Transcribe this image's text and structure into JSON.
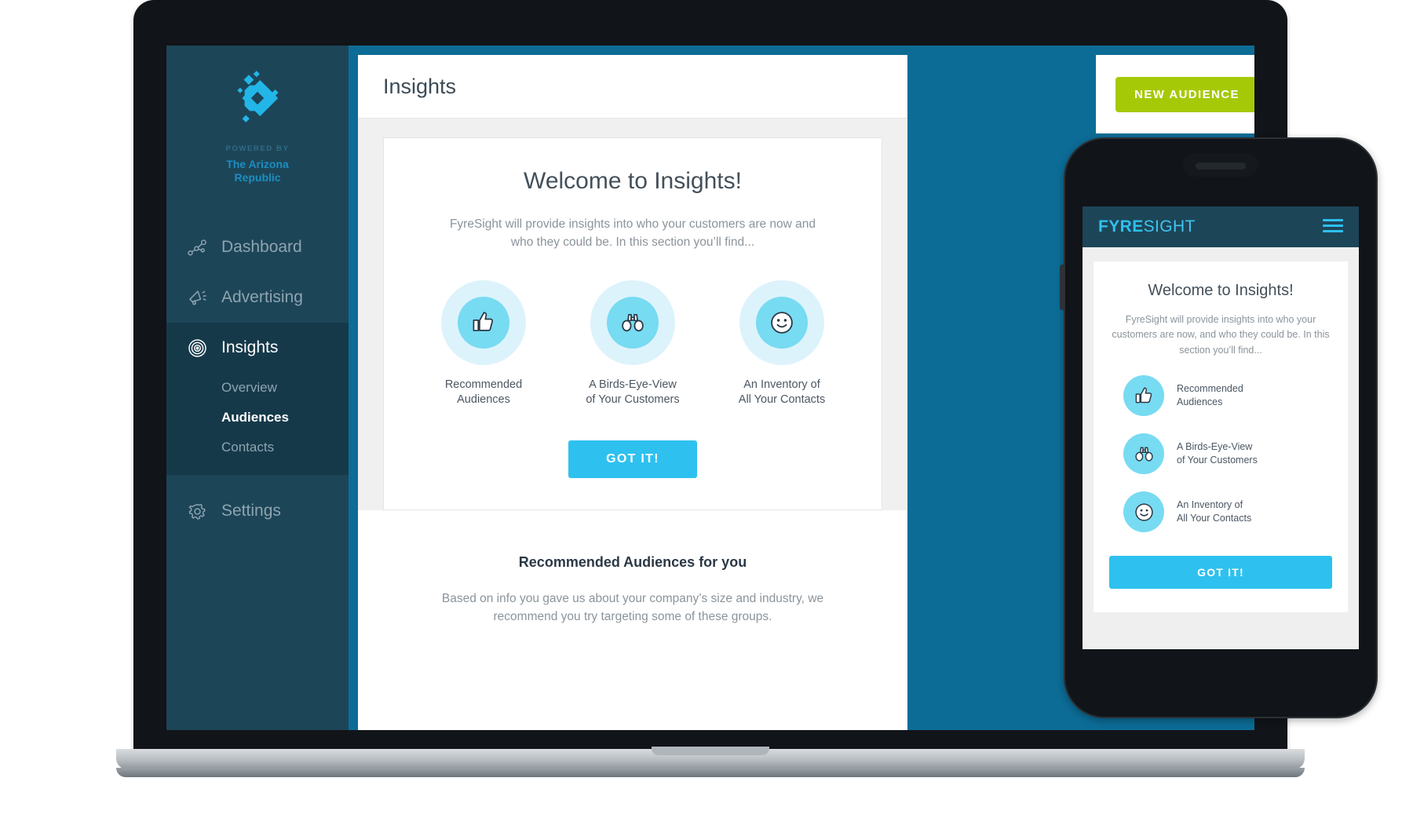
{
  "desktop": {
    "sidebar": {
      "logo_icon": "fyresight-diamond-logo-icon",
      "powered_by": "POWERED BY",
      "brand_line1": "The Arizona",
      "brand_line2": "Republic",
      "items": [
        {
          "label": "Dashboard",
          "icon": "dashboard-nodes-icon",
          "active": false
        },
        {
          "label": "Advertising",
          "icon": "megaphone-icon",
          "active": false
        },
        {
          "label": "Insights",
          "icon": "target-bullseye-icon",
          "active": true
        }
      ],
      "subitems": [
        {
          "label": "Overview",
          "current": false
        },
        {
          "label": "Audiences",
          "current": true
        },
        {
          "label": "Contacts",
          "current": false
        }
      ],
      "settings": {
        "label": "Settings",
        "icon": "gear-icon"
      }
    },
    "topbar": {
      "title": "Insights"
    },
    "callout": {
      "new_audience_label": "NEW AUDIENCE"
    },
    "welcome_card": {
      "heading": "Welcome to Insights!",
      "lede_line1": "FyreSight will provide insights into who your customers are now and",
      "lede_line2": "who they could be. In this section you’ll find...",
      "features": [
        {
          "icon": "thumbs-up-icon",
          "line1": "Recommended",
          "line2": "Audiences"
        },
        {
          "icon": "binoculars-icon",
          "line1": "A Birds-Eye-View",
          "line2": "of Your Customers"
        },
        {
          "icon": "smiley-face-icon",
          "line1": "An Inventory of",
          "line2": "All Your Contacts"
        }
      ],
      "got_it_label": "GOT IT!"
    },
    "recommended_section": {
      "heading": "Recommended Audiences for you",
      "sub_line1": "Based on info you gave us about your company’s size and industry,",
      "sub_line2": "we recommend you try targeting some of these groups."
    }
  },
  "mobile": {
    "header": {
      "brand_bold": "FYRE",
      "brand_light": "SIGHT",
      "menu_icon": "hamburger-menu-icon"
    },
    "welcome_card": {
      "heading": "Welcome to Insights!",
      "lede_line1": "FyreSight will provide insights into who",
      "lede_line2": "your customers are now, and who they",
      "lede_line3": "could be. In this section you’ll find...",
      "features": [
        {
          "icon": "thumbs-up-icon",
          "line1": "Recommended",
          "line2": "Audiences"
        },
        {
          "icon": "binoculars-icon",
          "line1": "A Birds-Eye-View",
          "line2": "of Your Customers"
        },
        {
          "icon": "smiley-face-icon",
          "line1": "An Inventory of",
          "line2": "All Your Contacts"
        }
      ],
      "got_it_label": "GOT IT!"
    }
  },
  "colors": {
    "sidebar_bg": "#1d4558",
    "sidebar_active": "#16394a",
    "app_blue": "#0c6c96",
    "accent_cyan": "#2ec1ef",
    "icon_circle": "#77dbf2",
    "icon_halo": "#ddf3fb",
    "accent_green": "#a6c907",
    "brand_cyan": "#1a8fc1"
  }
}
